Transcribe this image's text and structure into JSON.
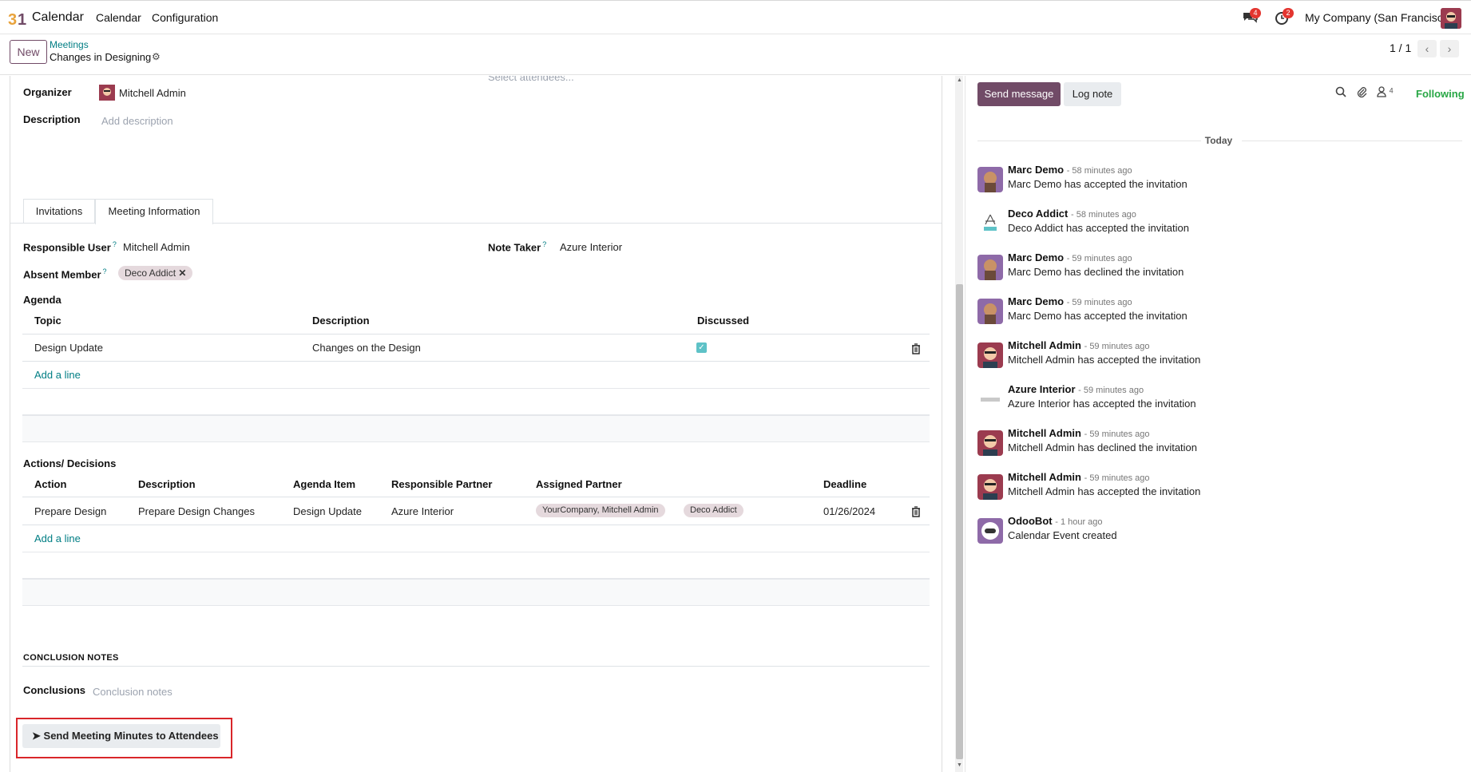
{
  "topnav": {
    "app_name": "Calendar",
    "menu": [
      "Calendar",
      "Configuration"
    ],
    "messages_badge": "4",
    "activities_badge": "2",
    "company": "My Company (San Francisco)"
  },
  "control": {
    "new_label": "New",
    "breadcrumb_parent": "Meetings",
    "breadcrumb_current": "Changes in Designing",
    "pager": "1 / 1"
  },
  "form": {
    "attendees_placeholder": "Select attendees...",
    "organizer_label": "Organizer",
    "organizer_value": "Mitchell Admin",
    "description_label": "Description",
    "description_placeholder": "Add description",
    "tabs": [
      "Invitations",
      "Meeting Information"
    ],
    "responsible_user_label": "Responsible User",
    "responsible_user_value": "Mitchell Admin",
    "note_taker_label": "Note Taker",
    "note_taker_value": "Azure Interior",
    "absent_member_label": "Absent Member",
    "absent_member_tag": "Deco Addict",
    "help_marker": "?",
    "agenda": {
      "title": "Agenda",
      "headers": [
        "Topic",
        "Description",
        "Discussed"
      ],
      "rows": [
        {
          "topic": "Design Update",
          "description": "Changes on the Design",
          "discussed": true
        }
      ],
      "add_line": "Add a line"
    },
    "actions": {
      "title": "Actions/ Decisions",
      "headers": [
        "Action",
        "Description",
        "Agenda Item",
        "Responsible Partner",
        "Assigned Partner",
        "Deadline"
      ],
      "rows": [
        {
          "action": "Prepare Design",
          "description": "Prepare Design Changes",
          "agenda_item": "Design Update",
          "responsible": "Azure Interior",
          "assigned": [
            "YourCompany, Mitchell Admin",
            "Deco Addict"
          ],
          "deadline": "01/26/2024"
        }
      ],
      "add_line": "Add a line"
    },
    "conclusion_heading": "CONCLUSION NOTES",
    "conclusions_label": "Conclusions",
    "conclusions_placeholder": "Conclusion notes",
    "send_minutes_label": "Send Meeting Minutes to Attendees"
  },
  "chatter": {
    "send_message": "Send message",
    "log_note": "Log note",
    "followers_count": "4",
    "following": "Following",
    "date_separator": "Today",
    "messages": [
      {
        "author": "Marc Demo",
        "time": "- 58 minutes ago",
        "body": "Marc Demo has accepted the invitation",
        "avatar": "marc"
      },
      {
        "author": "Deco Addict",
        "time": "- 58 minutes ago",
        "body": "Deco Addict has accepted the invitation",
        "avatar": "deco"
      },
      {
        "author": "Marc Demo",
        "time": "- 59 minutes ago",
        "body": "Marc Demo has declined the invitation",
        "avatar": "marc"
      },
      {
        "author": "Marc Demo",
        "time": "- 59 minutes ago",
        "body": "Marc Demo has accepted the invitation",
        "avatar": "marc"
      },
      {
        "author": "Mitchell Admin",
        "time": "- 59 minutes ago",
        "body": "Mitchell Admin has accepted the invitation",
        "avatar": "mitchell"
      },
      {
        "author": "Azure Interior",
        "time": "- 59 minutes ago",
        "body": "Azure Interior has accepted the invitation",
        "avatar": "azure"
      },
      {
        "author": "Mitchell Admin",
        "time": "- 59 minutes ago",
        "body": "Mitchell Admin has declined the invitation",
        "avatar": "mitchell"
      },
      {
        "author": "Mitchell Admin",
        "time": "- 59 minutes ago",
        "body": "Mitchell Admin has accepted the invitation",
        "avatar": "mitchell"
      },
      {
        "author": "OdooBot",
        "time": "- 1 hour ago",
        "body": "Calendar Event created",
        "avatar": "odoobot"
      }
    ]
  },
  "colors": {
    "brand": "#714b67",
    "link": "#017e84",
    "following": "#28a745",
    "highlight": "#d9262a"
  }
}
